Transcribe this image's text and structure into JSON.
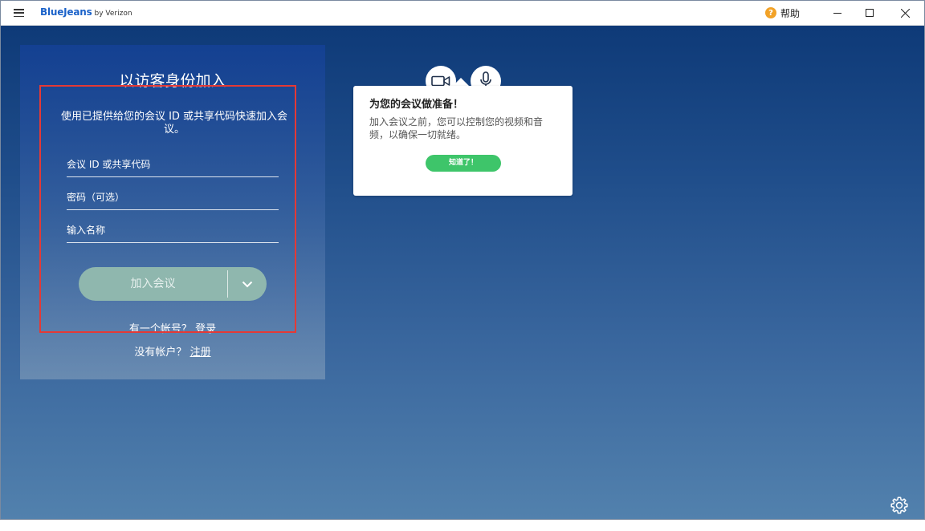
{
  "titlebar": {
    "brand": "BlueJeans",
    "brand_suffix": "by Verizon",
    "help_label": "帮助"
  },
  "join_panel": {
    "title": "以访客身份加入",
    "description": "使用已提供给您的会议 ID 或共享代码快速加入会议。",
    "meeting_id_placeholder": "会议 ID 或共享代码",
    "passcode_placeholder": "密码（可选）",
    "name_placeholder": "输入名称",
    "join_button_label": "加入会议",
    "have_account_text": "有一个帐号？",
    "login_link": "登录",
    "no_account_text": "没有帐户？",
    "signup_link": "注册"
  },
  "tooltip": {
    "title": "为您的会议做准备！",
    "body": "加入会议之前，您可以控制您的视频和音频，以确保一切就绪。",
    "ok_button": "知道了！"
  },
  "settings": {
    "label": "设置"
  },
  "colors": {
    "brand_blue": "#1b62c9",
    "join_button": "#8fb7ae",
    "ok_button": "#3ec56a",
    "highlight_box": "#e53935",
    "help_icon": "#f2a227"
  },
  "icons": {
    "menu": "hamburger-icon",
    "help": "question-circle-icon",
    "camera": "video-camera-icon",
    "mic": "microphone-icon",
    "settings": "gear-icon",
    "join_dropdown": "chevron-down-icon"
  }
}
